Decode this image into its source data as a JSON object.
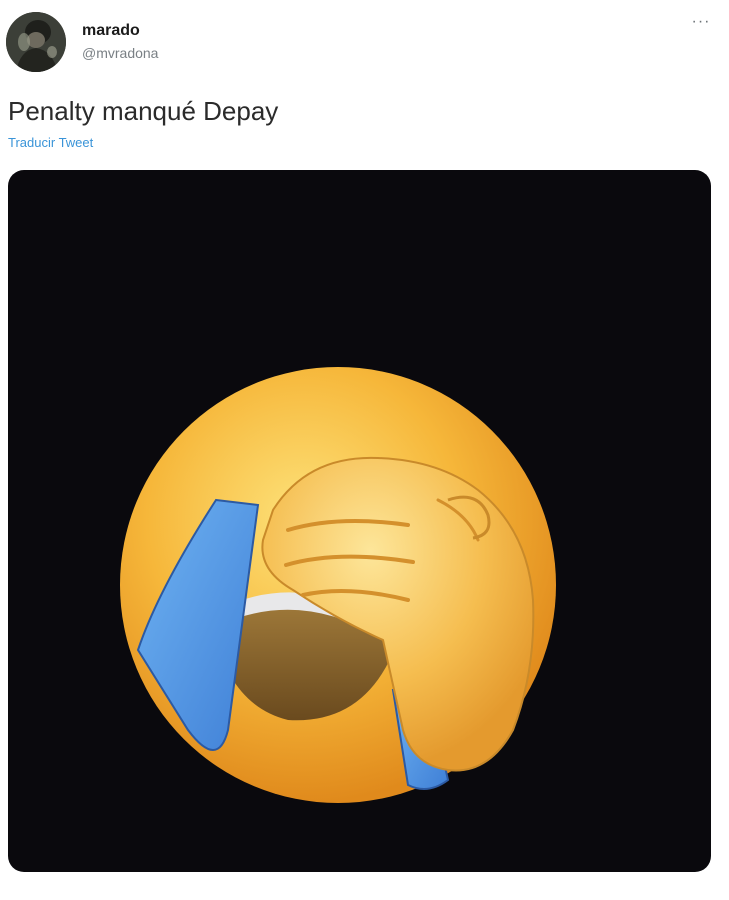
{
  "tweet": {
    "author": {
      "display_name": "marado",
      "handle": "@mvradona",
      "avatar_icon": "profile-avatar"
    },
    "more_icon": "more-options-icon",
    "more_label": "···",
    "text": "Penalty manqué Depay",
    "translate_label": "Traducir Tweet",
    "media": {
      "emoji": "face-palm-crying-emoji",
      "background": "#0a090d"
    }
  },
  "colors": {
    "link": "#3a94d8",
    "name": "#1b1b1b",
    "muted": "#7a8085",
    "emoji_face": "#f3b63a",
    "tears": "#4a8fe0"
  }
}
